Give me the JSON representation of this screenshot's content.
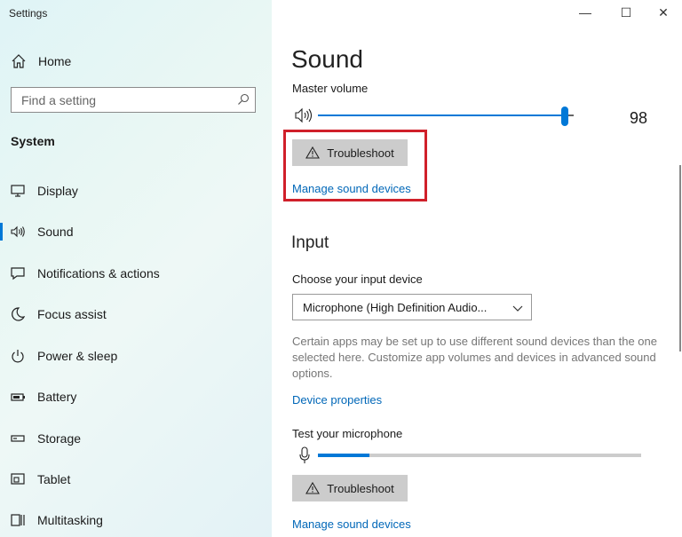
{
  "window": {
    "title": "Settings",
    "minimize_glyph": "—",
    "maximize_glyph": "☐",
    "close_glyph": "✕"
  },
  "sidebar": {
    "home_label": "Home",
    "home_icon": "home-icon",
    "search_placeholder": "Find a setting",
    "section": "System",
    "items": [
      {
        "label": "Display",
        "icon": "monitor-icon"
      },
      {
        "label": "Sound",
        "icon": "speaker-icon",
        "active": true
      },
      {
        "label": "Notifications & actions",
        "icon": "notification-icon"
      },
      {
        "label": "Focus assist",
        "icon": "moon-icon"
      },
      {
        "label": "Power & sleep",
        "icon": "power-icon"
      },
      {
        "label": "Battery",
        "icon": "battery-icon"
      },
      {
        "label": "Storage",
        "icon": "storage-icon"
      },
      {
        "label": "Tablet",
        "icon": "tablet-icon"
      },
      {
        "label": "Multitasking",
        "icon": "multitasking-icon"
      }
    ]
  },
  "main": {
    "title": "Sound",
    "master_volume_label": "Master volume",
    "master_volume_value": "98",
    "master_volume_level": 0.98,
    "troubleshoot_label": "Troubleshoot",
    "manage_devices_link": "Manage sound devices",
    "input_heading": "Input",
    "input_device_label": "Choose your input device",
    "input_device_selected": "Microphone (High Definition Audio...",
    "description": "Certain apps may be set up to use different sound devices than the one selected here. Customize app volumes and devices in advanced sound options.",
    "device_properties_link": "Device properties",
    "test_mic_label": "Test your microphone",
    "mic_level": 0.16,
    "troubleshoot_label_2": "Troubleshoot",
    "manage_devices_link_2": "Manage sound devices"
  },
  "colors": {
    "accent": "#0078d7",
    "link": "#0067b8",
    "highlight": "#d0202a"
  }
}
